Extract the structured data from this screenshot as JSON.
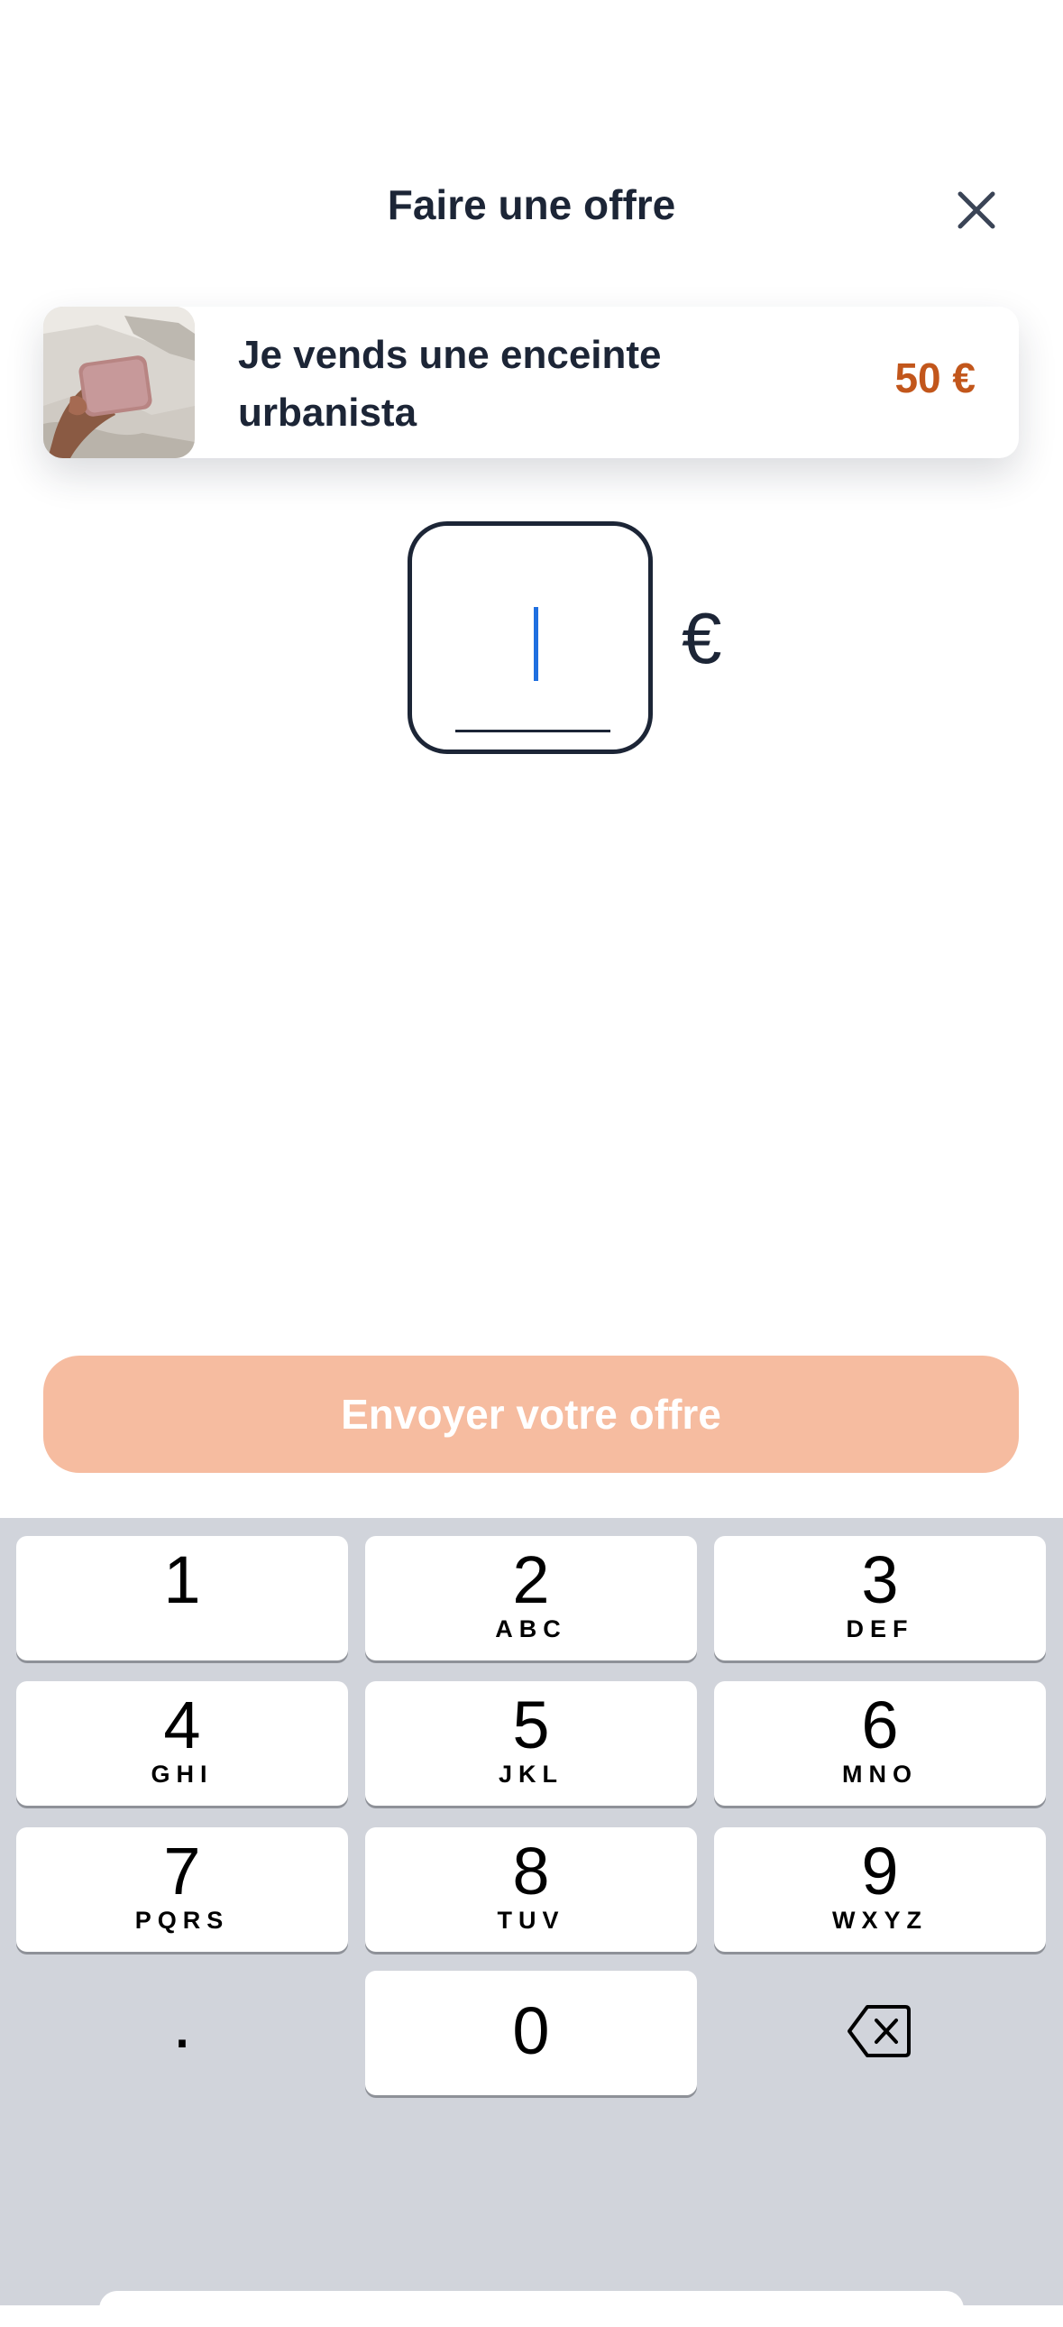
{
  "header": {
    "title": "Faire une offre"
  },
  "product": {
    "title": "Je vends une enceinte urbanista",
    "price": "50 €"
  },
  "offer": {
    "value": "",
    "currency": "€"
  },
  "submit": {
    "label": "Envoyer votre offre",
    "color": "#f6bca0"
  },
  "keypad": {
    "keys": [
      {
        "digit": "1",
        "letters": ""
      },
      {
        "digit": "2",
        "letters": "ABC"
      },
      {
        "digit": "3",
        "letters": "DEF"
      },
      {
        "digit": "4",
        "letters": "GHI"
      },
      {
        "digit": "5",
        "letters": "JKL"
      },
      {
        "digit": "6",
        "letters": "MNO"
      },
      {
        "digit": "7",
        "letters": "PQRS"
      },
      {
        "digit": "8",
        "letters": "TUV"
      },
      {
        "digit": "9",
        "letters": "WXYZ"
      },
      {
        "digit": "0",
        "letters": ""
      }
    ],
    "decimal": ".",
    "backspace_icon": "backspace-icon"
  },
  "colors": {
    "accent": "#c2561b",
    "text": "#1c2536",
    "caret": "#1f6fe0",
    "keypad_bg": "#d1d4db"
  }
}
